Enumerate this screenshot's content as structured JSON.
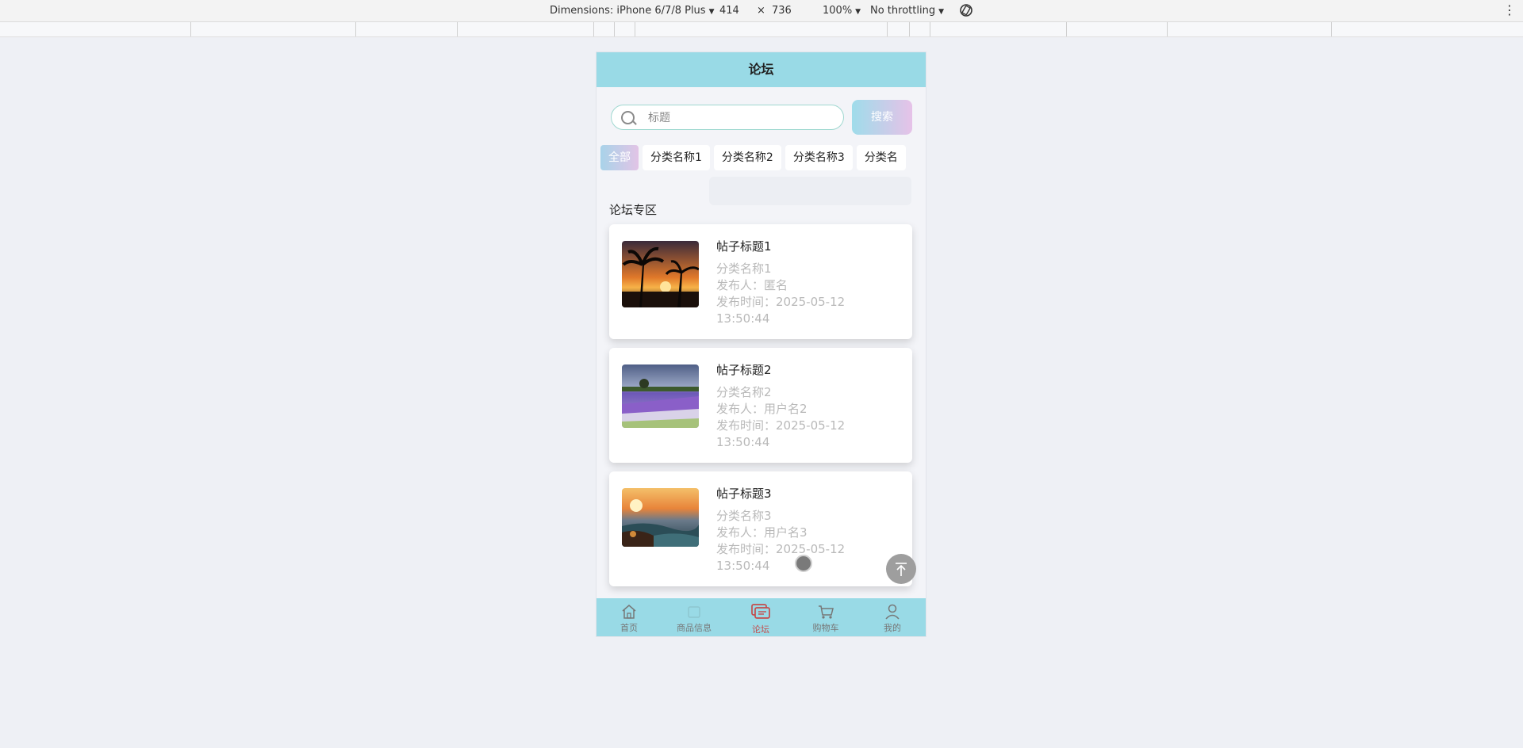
{
  "devtools": {
    "device": "Dimensions: iPhone 6/7/8 Plus",
    "width": "414",
    "times": "×",
    "height": "736",
    "zoom": "100%",
    "throttling": "No throttling"
  },
  "header": {
    "title": "论坛"
  },
  "search": {
    "placeholder": "标题",
    "button": "搜索"
  },
  "categories": [
    "全部",
    "分类名称1",
    "分类名称2",
    "分类名称3",
    "分类名"
  ],
  "section_title": "论坛专区",
  "posts": [
    {
      "title": "帖子标题1",
      "category": "分类名称1",
      "author": "发布人：匿名",
      "time": "发布时间：2025-05-12 13:50:44",
      "image": "palm-sunset"
    },
    {
      "title": "帖子标题2",
      "category": "分类名称2",
      "author": "发布人：用户名2",
      "time": "发布时间：2025-05-12 13:50:44",
      "image": "lavender-field"
    },
    {
      "title": "帖子标题3",
      "category": "分类名称3",
      "author": "发布人：用户名3",
      "time": "发布时间：2025-05-12 13:50:44",
      "image": "sea-sunset"
    }
  ],
  "tabbar": [
    {
      "label": "首页",
      "icon": "home-icon"
    },
    {
      "label": "商品信息",
      "icon": "goods-icon"
    },
    {
      "label": "论坛",
      "icon": "chat-icon",
      "active": true
    },
    {
      "label": "购物车",
      "icon": "cart-icon"
    },
    {
      "label": "我的",
      "icon": "user-icon"
    }
  ],
  "colors": {
    "header": "#99dae6",
    "tabbar": "#99dae6",
    "active_tab": "#c44c4c"
  }
}
